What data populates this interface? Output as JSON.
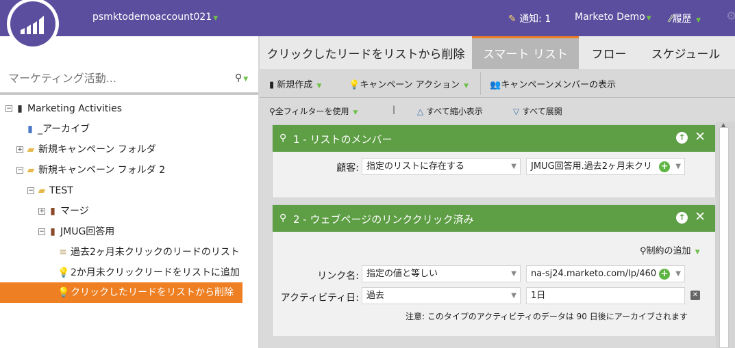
{
  "header": {
    "account": "psmktodemoaccount021",
    "notifications": "通知: 1",
    "user": "Marketo Demo",
    "history": "履歴"
  },
  "sidebar": {
    "search_placeholder": "マーケティング活動...",
    "tree": [
      {
        "label": "Marketing Activities"
      },
      {
        "label": "_アーカイブ"
      },
      {
        "label": "新規キャンペーン フォルダ"
      },
      {
        "label": "新規キャンペーン フォルダ 2"
      },
      {
        "label": "TEST"
      },
      {
        "label": "マージ"
      },
      {
        "label": "JMUG回答用"
      },
      {
        "label": "過去2ヶ月未クリックのリードのリスト"
      },
      {
        "label": "2か月未クリックリードをリストに追加"
      },
      {
        "label": "クリックしたリードをリストから削除"
      }
    ]
  },
  "tabs": [
    {
      "label": "クリックしたリードをリストから削除"
    },
    {
      "label": "スマート リスト"
    },
    {
      "label": "フロー"
    },
    {
      "label": "スケジュール"
    }
  ],
  "toolbar": {
    "new": "新規作成",
    "campaign_action": "キャンペーン アクション",
    "show_members": "キャンペーンメンバーの表示"
  },
  "filterbar": {
    "use_all": "全フィルターを使用",
    "separator": "|",
    "collapse_all": "すべて縮小表示",
    "expand_all": "すべて展開"
  },
  "filters": [
    {
      "title": "1 - リストのメンバー",
      "rows": [
        {
          "label": "顧客:",
          "operator": "指定のリストに存在する",
          "value": "JMUG回答用.過去2ヶ月未クリ"
        }
      ]
    },
    {
      "title": "2 - ウェブページのリンククリック済み",
      "add_constraint": "制約の追加",
      "rows": [
        {
          "label": "リンク名:",
          "operator": "指定の値と等しい",
          "value": "na-sj24.marketo.com/lp/460"
        },
        {
          "label": "アクティビティ日:",
          "operator": "過去",
          "value": "1日"
        }
      ],
      "note": "注意: このタイプのアクティビティのデータは 90 日後にアーカイブされます"
    }
  ],
  "colors": {
    "header_bg": "#5c4e9e",
    "accent_orange": "#ee7f22",
    "filter_green": "#5e9e45"
  }
}
